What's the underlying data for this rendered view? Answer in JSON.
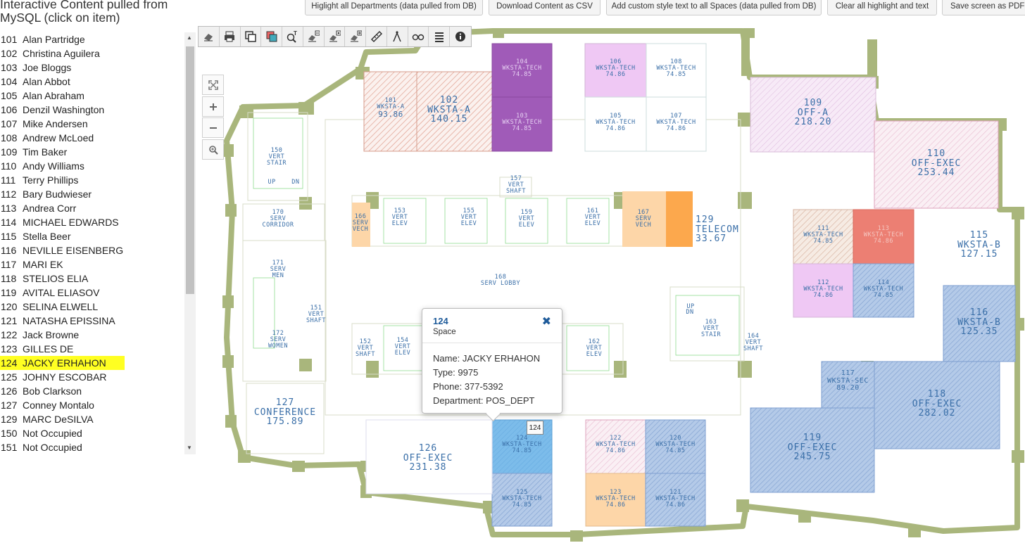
{
  "panel": {
    "title": "Interactive Content pulled from MySQL (click on item)",
    "items": [
      {
        "num": "101",
        "name": "Alan Partridge"
      },
      {
        "num": "102",
        "name": "Christina Aguilera"
      },
      {
        "num": "103",
        "name": "Joe Bloggs"
      },
      {
        "num": "104",
        "name": "Alan Abbot"
      },
      {
        "num": "105",
        "name": "Alan Abraham"
      },
      {
        "num": "106",
        "name": "Denzil Washington"
      },
      {
        "num": "107",
        "name": "Mike Andersen"
      },
      {
        "num": "108",
        "name": "Andrew McLoed"
      },
      {
        "num": "109",
        "name": "Tim Baker"
      },
      {
        "num": "110",
        "name": "Andy Williams"
      },
      {
        "num": "111",
        "name": "Terry Phillips"
      },
      {
        "num": "112",
        "name": "Bary Budwieser"
      },
      {
        "num": "113",
        "name": "Andrea Corr"
      },
      {
        "num": "114",
        "name": "MICHAEL EDWARDS"
      },
      {
        "num": "115",
        "name": "Stella Beer"
      },
      {
        "num": "116",
        "name": "NEVILLE EISENBERG"
      },
      {
        "num": "117",
        "name": "MARI EK"
      },
      {
        "num": "118",
        "name": "STELIOS ELIA"
      },
      {
        "num": "119",
        "name": "AVITAL ELIASOV"
      },
      {
        "num": "120",
        "name": "SELINA ELWELL"
      },
      {
        "num": "121",
        "name": "NATASHA EPISSINA"
      },
      {
        "num": "122",
        "name": "Jack Browne"
      },
      {
        "num": "123",
        "name": "GILLES DE"
      },
      {
        "num": "124",
        "name": "JACKY ERHAHON",
        "selected": true
      },
      {
        "num": "125",
        "name": "JOHNY ESCOBAR"
      },
      {
        "num": "126",
        "name": "Bob Clarkson"
      },
      {
        "num": "127",
        "name": "Conney Montalo"
      },
      {
        "num": "129",
        "name": "MARC DeSILVA"
      },
      {
        "num": "150",
        "name": "Not Occupied"
      },
      {
        "num": "151",
        "name": "Not Occupied"
      }
    ]
  },
  "top_buttons": [
    {
      "label": "Higlight all Departments (data pulled from DB)"
    },
    {
      "label": "Download Content as CSV"
    },
    {
      "label": "Add custom style text to all Spaces (data pulled from DB)"
    },
    {
      "label": "Clear all highlight and text"
    },
    {
      "label": "Save screen as PDF"
    }
  ],
  "toolbar_icons": [
    "eraser-icon",
    "print-icon",
    "layers-icon",
    "layers-color-icon",
    "text-search-icon",
    "eraser-minus-icon",
    "eraser-gear-icon",
    "eraser-plus-icon",
    "ruler-icon",
    "compass-icon",
    "binoculars-icon",
    "list-icon",
    "info-icon"
  ],
  "zoom_icons": [
    "fullscreen-icon",
    "zoom-in-icon",
    "zoom-out-icon",
    "zoom-search-icon"
  ],
  "popup": {
    "id": "124",
    "kind": "Space",
    "name_line": "Name: JACKY ERHAHON",
    "type_line": "Type: 9975",
    "phone_line": "Phone: 377-5392",
    "dept_line": "Department: POS_DEPT",
    "tag": "124"
  },
  "rooms": [
    {
      "id": "101",
      "name": "WKSTA-A",
      "area": "93.86"
    },
    {
      "id": "102",
      "name": "WKSTA-A",
      "area": "140.15"
    },
    {
      "id": "103",
      "name": "WKSTA-TECH",
      "area": "74.85"
    },
    {
      "id": "104",
      "name": "WKSTA-TECH",
      "area": "74.85"
    },
    {
      "id": "105",
      "name": "WKSTA-TECH",
      "area": "74.86"
    },
    {
      "id": "106",
      "name": "WKSTA-TECH",
      "area": "74.86"
    },
    {
      "id": "107",
      "name": "WKSTA-TECH",
      "area": "74.86"
    },
    {
      "id": "108",
      "name": "WKSTA-TECH",
      "area": "74.85"
    },
    {
      "id": "109",
      "name": "OFF-A",
      "area": "218.20"
    },
    {
      "id": "110",
      "name": "OFF-EXEC",
      "area": "253.44"
    },
    {
      "id": "111",
      "name": "WKSTA-TECH",
      "area": "74.85"
    },
    {
      "id": "112",
      "name": "WKSTA-TECH",
      "area": "74.86"
    },
    {
      "id": "113",
      "name": "WKSTA-TECH",
      "area": "74.86"
    },
    {
      "id": "114",
      "name": "WKSTA-TECH",
      "area": "74.85"
    },
    {
      "id": "115",
      "name": "WKSTA-B",
      "area": "127.15"
    },
    {
      "id": "116",
      "name": "WKSTA-B",
      "area": "125.35"
    },
    {
      "id": "117",
      "name": "WKSTA-SEC",
      "area": "89.20"
    },
    {
      "id": "118",
      "name": "OFF-EXEC",
      "area": "282.02"
    },
    {
      "id": "119",
      "name": "OFF-EXEC",
      "area": "245.75"
    },
    {
      "id": "120",
      "name": "WKSTA-TECH",
      "area": "74.85"
    },
    {
      "id": "121",
      "name": "WKSTA-TECH",
      "area": "74.86"
    },
    {
      "id": "122",
      "name": "WKSTA-TECH",
      "area": "74.86"
    },
    {
      "id": "123",
      "name": "WKSTA-TECH",
      "area": "74.86"
    },
    {
      "id": "124",
      "name": "WKSTA-TECH",
      "area": "74.85"
    },
    {
      "id": "125",
      "name": "WKSTA-TECH",
      "area": "74.85"
    },
    {
      "id": "126",
      "name": "OFF-EXEC",
      "area": "231.38"
    },
    {
      "id": "127",
      "name": "CONFERENCE",
      "area": "175.89"
    },
    {
      "id": "129",
      "name": "TELECOM",
      "area": "33.67"
    },
    {
      "id": "150",
      "name": "VERT STAIR",
      "area": ""
    },
    {
      "id": "151",
      "name": "VERT SHAFT",
      "area": ""
    },
    {
      "id": "152",
      "name": "VERT SHAFT",
      "area": ""
    },
    {
      "id": "153",
      "name": "VERT ELEV",
      "area": ""
    },
    {
      "id": "154",
      "name": "VERT ELEV",
      "area": ""
    },
    {
      "id": "155",
      "name": "VERT ELEV",
      "area": ""
    },
    {
      "id": "157",
      "name": "VERT SHAFT",
      "area": ""
    },
    {
      "id": "159",
      "name": "VERT ELEV",
      "area": ""
    },
    {
      "id": "161",
      "name": "VERT ELEV",
      "area": ""
    },
    {
      "id": "162",
      "name": "VERT ELEV",
      "area": ""
    },
    {
      "id": "163",
      "name": "VERT STAIR",
      "area": ""
    },
    {
      "id": "164",
      "name": "VERT SHAFT",
      "area": ""
    },
    {
      "id": "166",
      "name": "SERV VECH",
      "area": ""
    },
    {
      "id": "167",
      "name": "SERV VECH",
      "area": ""
    },
    {
      "id": "168",
      "name": "SERV LOBBY",
      "area": ""
    },
    {
      "id": "170",
      "name": "SERV CORRIDOR",
      "area": ""
    },
    {
      "id": "171",
      "name": "SERV MEN",
      "area": ""
    },
    {
      "id": "172",
      "name": "SERV WOMEN",
      "area": ""
    }
  ],
  "stair_labels": {
    "up": "UP",
    "dn": "DN"
  },
  "colors": {
    "wall": "#a9b67c",
    "purple_dark": "#a05bb8",
    "lavender": "#efc8f4",
    "pink": "#f5d9e4",
    "orange_light": "#fdd6a8",
    "orange": "#fca84d",
    "salmon": "#ec7f73",
    "blue_hatch": "#9bb7de",
    "blue_selected": "#7cbcea",
    "highlight": "#ffff22"
  }
}
